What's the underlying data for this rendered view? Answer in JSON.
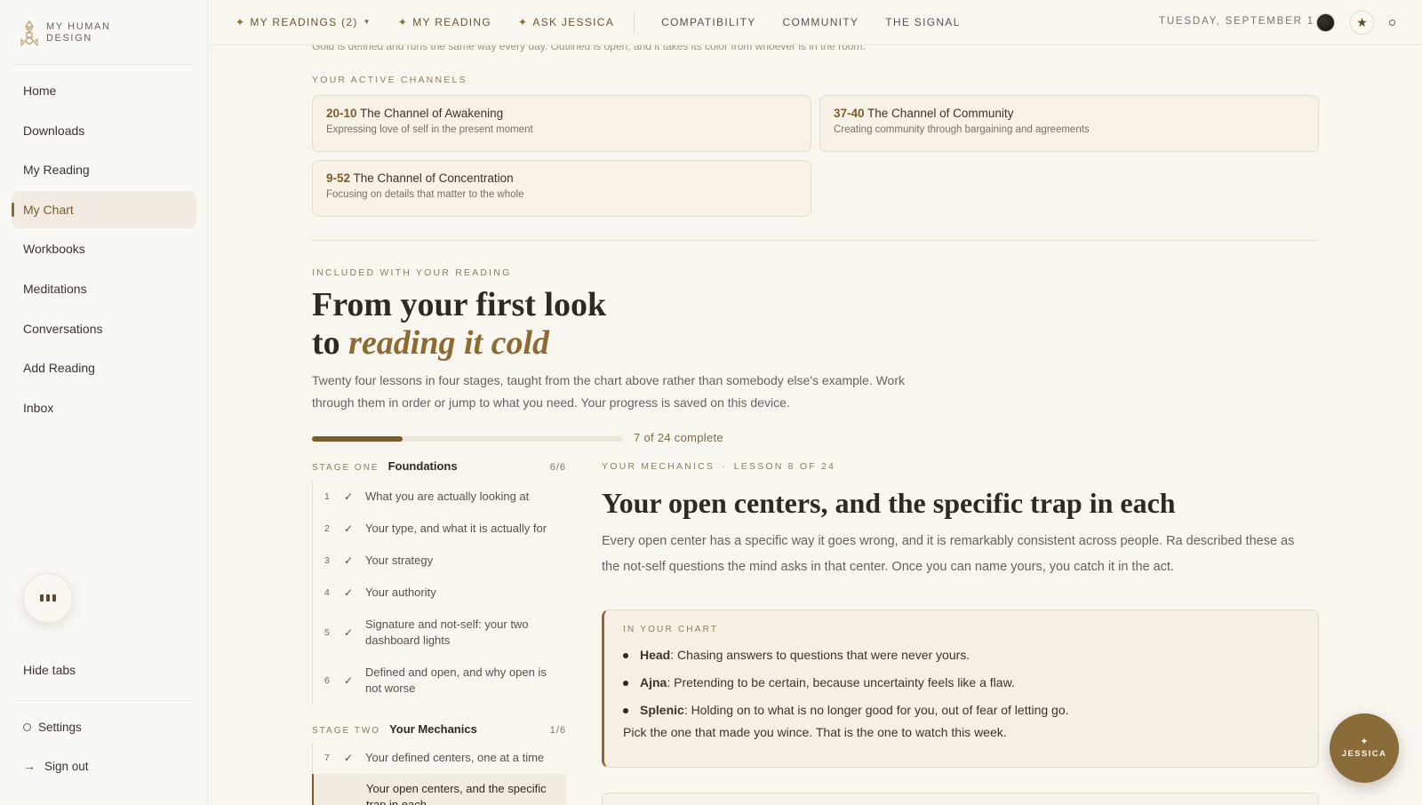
{
  "brand": {
    "line1": "MY HUMAN",
    "line2": "DESIGN"
  },
  "sidebar": {
    "items": [
      {
        "label": "Home",
        "active": false
      },
      {
        "label": "Downloads",
        "active": false
      },
      {
        "label": "My Reading",
        "active": false
      },
      {
        "label": "My Chart",
        "active": true
      },
      {
        "label": "Workbooks",
        "active": false
      },
      {
        "label": "Meditations",
        "active": false
      },
      {
        "label": "Conversations",
        "active": false
      },
      {
        "label": "Add Reading",
        "active": false
      },
      {
        "label": "Inbox",
        "active": false
      }
    ],
    "hide_tabs": "Hide tabs",
    "settings": "Settings",
    "sign_out": "Sign out"
  },
  "topbar": {
    "links": [
      {
        "label": "MY READINGS (2)",
        "star": "✦",
        "dropdown": true
      },
      {
        "label": "MY READING",
        "star": "✦"
      },
      {
        "label": "ASK JESSICA",
        "star": "✦"
      }
    ],
    "plain_links": [
      "COMPATIBILITY",
      "COMMUNITY",
      "THE SIGNAL"
    ],
    "date": "TUESDAY, SEPTEMBER 1"
  },
  "main": {
    "cut_text": "Gold is defined and runs the same way every day. Outlined is open, and it takes its color from whoever is in the room.",
    "channels_label": "YOUR ACTIVE CHANNELS",
    "channels": [
      {
        "code": "20-10",
        "name": "The Channel of Awakening",
        "desc": "Expressing love of self in the present moment"
      },
      {
        "code": "37-40",
        "name": "The Channel of Community",
        "desc": "Creating community through bargaining and agreements"
      },
      {
        "code": "9-52",
        "name": "The Channel of Concentration",
        "desc": "Focusing on details that matter to the whole"
      }
    ],
    "included_label": "INCLUDED WITH YOUR READING",
    "headline_line1": "From your first look",
    "headline_to": "to",
    "headline_em": "reading it cold",
    "intro": "Twenty four lessons in four stages, taught from the chart above rather than somebody else's example. Work through them in order or jump to what you need. Your progress is saved on this device.",
    "progress": {
      "completed": 7,
      "total": 24,
      "label": "7 of 24 complete"
    }
  },
  "course": {
    "stages": [
      {
        "number_label": "STAGE ONE",
        "title": "Foundations",
        "count": "6/6",
        "lessons": [
          {
            "n": "1",
            "check": "✓",
            "title": "What you are actually looking at"
          },
          {
            "n": "2",
            "check": "✓",
            "title": "Your type, and what it is actually for"
          },
          {
            "n": "3",
            "check": "✓",
            "title": "Your strategy"
          },
          {
            "n": "4",
            "check": "✓",
            "title": "Your authority"
          },
          {
            "n": "5",
            "check": "✓",
            "title": "Signature and not-self: your two dashboard lights"
          },
          {
            "n": "6",
            "check": "✓",
            "title": "Defined and open, and why open is not worse"
          }
        ]
      },
      {
        "number_label": "STAGE TWO",
        "title": "Your Mechanics",
        "count": "1/6",
        "lessons": [
          {
            "n": "7",
            "check": "✓",
            "title": "Your defined centers, one at a time"
          },
          {
            "n": "",
            "check": "",
            "title": "Your open centers, and the specific trap in each",
            "current": true
          }
        ]
      }
    ]
  },
  "lesson": {
    "section": "YOUR MECHANICS",
    "separator": "·",
    "position": "LESSON 8 OF 24",
    "title": "Your open centers, and the specific trap in each",
    "body": "Every open center has a specific way it goes wrong, and it is remarkably consistent across people. Ra described these as the not-self questions the mind asks in that center. Once you can name yours, you catch it in the act.",
    "callout": {
      "label": "IN YOUR CHART",
      "items": [
        {
          "center": "Head",
          "text": ": Chasing answers to questions that were never yours."
        },
        {
          "center": "Ajna",
          "text": ": Pretending to be certain, because uncertainty feels like a flaw."
        },
        {
          "center": "Splenic",
          "text": ": Holding on to what is no longer good for you, out of fear of letting go."
        }
      ],
      "closing": "Pick the one that made you wince. That is the one to watch this week."
    }
  },
  "fab": {
    "star": "✦",
    "label": "JESSICA"
  },
  "colors": {
    "accent": "#8c6a34",
    "background": "#f9f6f0",
    "fab": "#8a6b3a"
  }
}
